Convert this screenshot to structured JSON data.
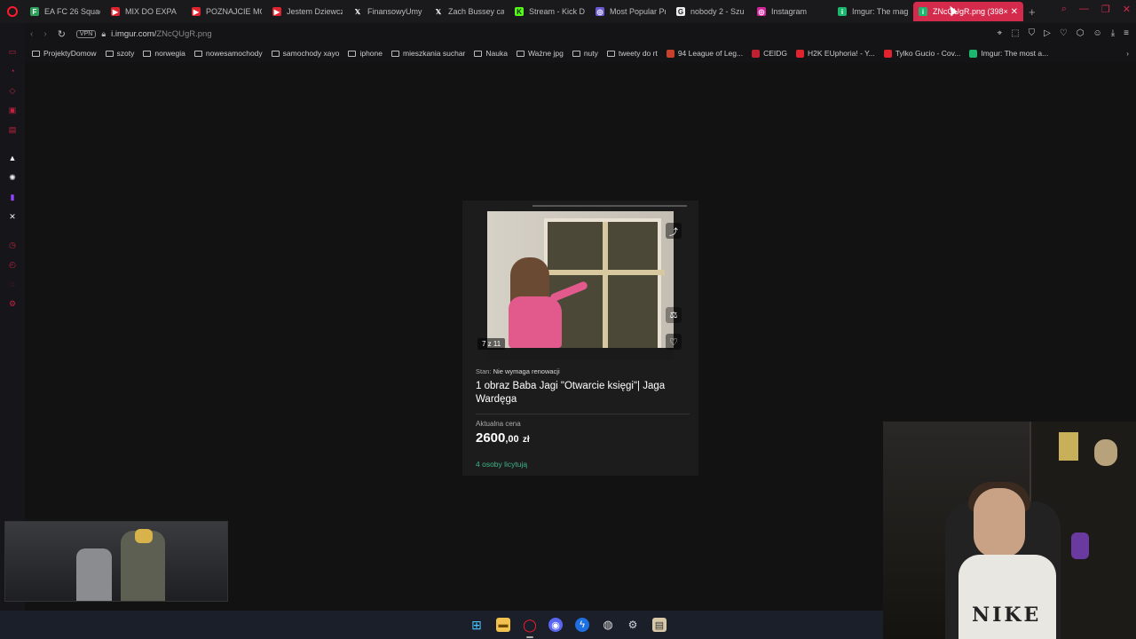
{
  "tabs": [
    {
      "title": "EA FC 26 Squad",
      "fav_color": "#2e9e5b",
      "glyph": "F"
    },
    {
      "title": "MIX DO EXPA",
      "fav_color": "#e0232e",
      "glyph": "▶"
    },
    {
      "title": "POZNAJCIE MOJ",
      "fav_color": "#e0232e",
      "glyph": "▶"
    },
    {
      "title": "Jestem Dziewczy",
      "fav_color": "#e0232e",
      "glyph": "▶"
    },
    {
      "title": "FinansowyUmy",
      "fav_color": "#1a1a1d",
      "glyph": "𝕏"
    },
    {
      "title": "Zach Bussey ca",
      "fav_color": "#1a1a1d",
      "glyph": "𝕏"
    },
    {
      "title": "Stream - Kick D",
      "fav_color": "#53fc18",
      "glyph": "K"
    },
    {
      "title": "Most Popular Pr",
      "fav_color": "#6b5bd6",
      "glyph": "◎"
    },
    {
      "title": "nobody 2 - Szu",
      "fav_color": "#eeeeee",
      "glyph": "G"
    },
    {
      "title": "Instagram",
      "fav_color": "#d6249f",
      "glyph": "◎"
    },
    {
      "title": "Imgur: The mag",
      "fav_color": "#1bb76e",
      "glyph": "i"
    }
  ],
  "active_tab": {
    "title": "ZNcQUgR.png (398×",
    "fav_color": "#1bb76e",
    "close": "✕"
  },
  "new_tab_glyph": "+",
  "address": {
    "vpn": "VPN",
    "host": "i.imgur.com/",
    "path": "ZNcQUgR.png"
  },
  "bookmarks": [
    {
      "label": "ProjektyDomow",
      "type": "folder"
    },
    {
      "label": "szoty",
      "type": "folder"
    },
    {
      "label": "norwegia",
      "type": "folder"
    },
    {
      "label": "nowesamochody",
      "type": "folder"
    },
    {
      "label": "samochody xayo",
      "type": "folder"
    },
    {
      "label": "iphone",
      "type": "folder"
    },
    {
      "label": "mieszkania suchar",
      "type": "folder"
    },
    {
      "label": "Nauka",
      "type": "folder"
    },
    {
      "label": "Ważne jpg",
      "type": "folder"
    },
    {
      "label": "nuty",
      "type": "folder"
    },
    {
      "label": "tweety do rt",
      "type": "folder"
    },
    {
      "label": "94 League of Leg...",
      "type": "site",
      "color": "#c8412a"
    },
    {
      "label": "CEIDG",
      "type": "site",
      "color": "#c02030"
    },
    {
      "label": "H2K EUphoria! - Y...",
      "type": "site",
      "color": "#e0232e"
    },
    {
      "label": "Tylko Gucio - Cov...",
      "type": "site",
      "color": "#e0232e"
    },
    {
      "label": "Imgur: The most a...",
      "type": "site",
      "color": "#1bb76e"
    }
  ],
  "listing": {
    "photo_counter": "7 z 11",
    "condition_label": "Stan:",
    "condition_value": "Nie wymaga renowacji",
    "title": "1 obraz Baba Jagi \"Otwarcie księgi\"| Jaga Wardęga",
    "price_label": "Aktualna cena",
    "price_int": "2600",
    "price_dec": ",00",
    "price_currency": "zł",
    "bidders": "4 osoby licytują"
  },
  "webcam_shirt_text": "NIKE"
}
